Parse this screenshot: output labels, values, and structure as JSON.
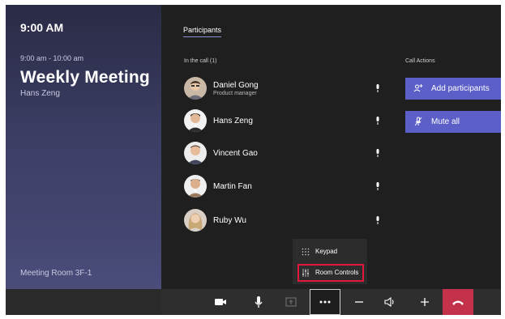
{
  "meeting": {
    "time": "9:00 AM",
    "range": "9:00 am - 10:00 am",
    "title": "Weekly Meeting",
    "organizer": "Hans Zeng",
    "room": "Meeting Room 3F-1"
  },
  "tabs": [
    "Participants"
  ],
  "in_call_label": "In the call (1)",
  "call_actions_label": "Call Actions",
  "participants": [
    {
      "name": "Daniel Gong",
      "role": "Product manager",
      "avatar": "avatar-photo"
    },
    {
      "name": "Hans Zeng",
      "role": "",
      "avatar": "avatar-photo"
    },
    {
      "name": "Vincent Gao",
      "role": "",
      "avatar": "avatar-photo"
    },
    {
      "name": "Martin Fan",
      "role": "",
      "avatar": "avatar-photo"
    },
    {
      "name": "Ruby Wu",
      "role": "",
      "avatar": "avatar-photo"
    }
  ],
  "actions": {
    "add_participants": "Add participants",
    "mute_all": "Mute all"
  },
  "more_menu": {
    "keypad": "Keypad",
    "room_controls": "Room Controls"
  },
  "controls": [
    "camera-icon",
    "microphone-icon",
    "share-icon",
    "more-icon",
    "volume-down-icon",
    "speaker-icon",
    "volume-up-icon",
    "hang-up-icon"
  ],
  "colors": {
    "accent": "#5b5fc7",
    "hangup": "#c4314b",
    "highlight": "#e0173a"
  }
}
